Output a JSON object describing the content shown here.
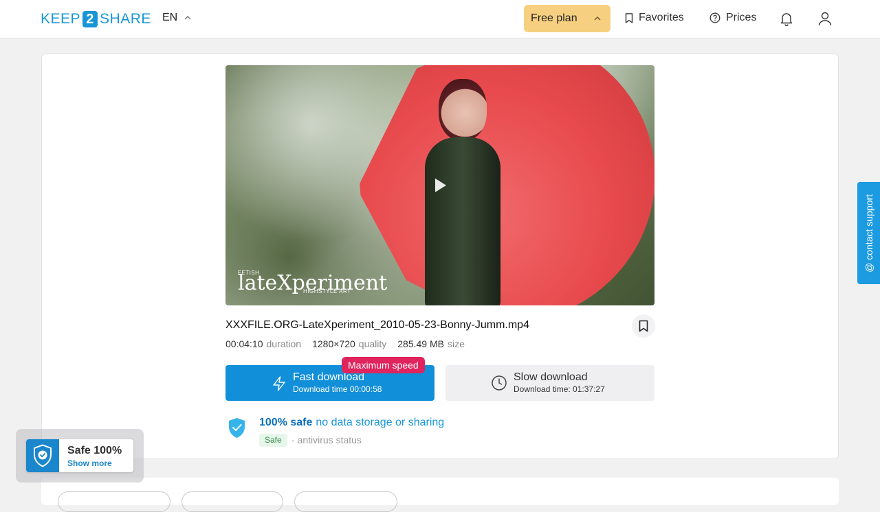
{
  "header": {
    "logo_left": "KEEP",
    "logo_mid": "2",
    "logo_right": "SHARE",
    "language": "EN",
    "plan_label": "Free plan",
    "favorites_label": "Favorites",
    "prices_label": "Prices"
  },
  "video": {
    "watermark_small": "FETISH",
    "watermark_main": "lateXperiment",
    "watermark_sub": "HIGHSTYLE ART"
  },
  "file": {
    "name": "XXXFILE.ORG-LateXperiment_2010-05-23-Bonny-Jumm.mp4",
    "duration_value": "00:04:10",
    "duration_label": "duration",
    "quality_value": "1280×720",
    "quality_label": "quality",
    "size_value": "285.49 MB",
    "size_label": "size"
  },
  "download": {
    "fast_title": "Fast download",
    "fast_time": "Download time 00:00:58",
    "max_speed_badge": "Maximum speed",
    "slow_title": "Slow download",
    "slow_time": "Download time: 01:37:27"
  },
  "safety": {
    "strong": "100% safe",
    "rest": "no data storage or sharing",
    "badge": "Safe",
    "status": "- antivirus status"
  },
  "contact_support": "@ contact support",
  "safe_widget": {
    "title": "Safe 100%",
    "link": "Show more"
  },
  "colors": {
    "brand": "#1795d6",
    "plan_bg": "#f7cf80",
    "fast_btn": "#128fd9",
    "badge": "#e0245e"
  }
}
